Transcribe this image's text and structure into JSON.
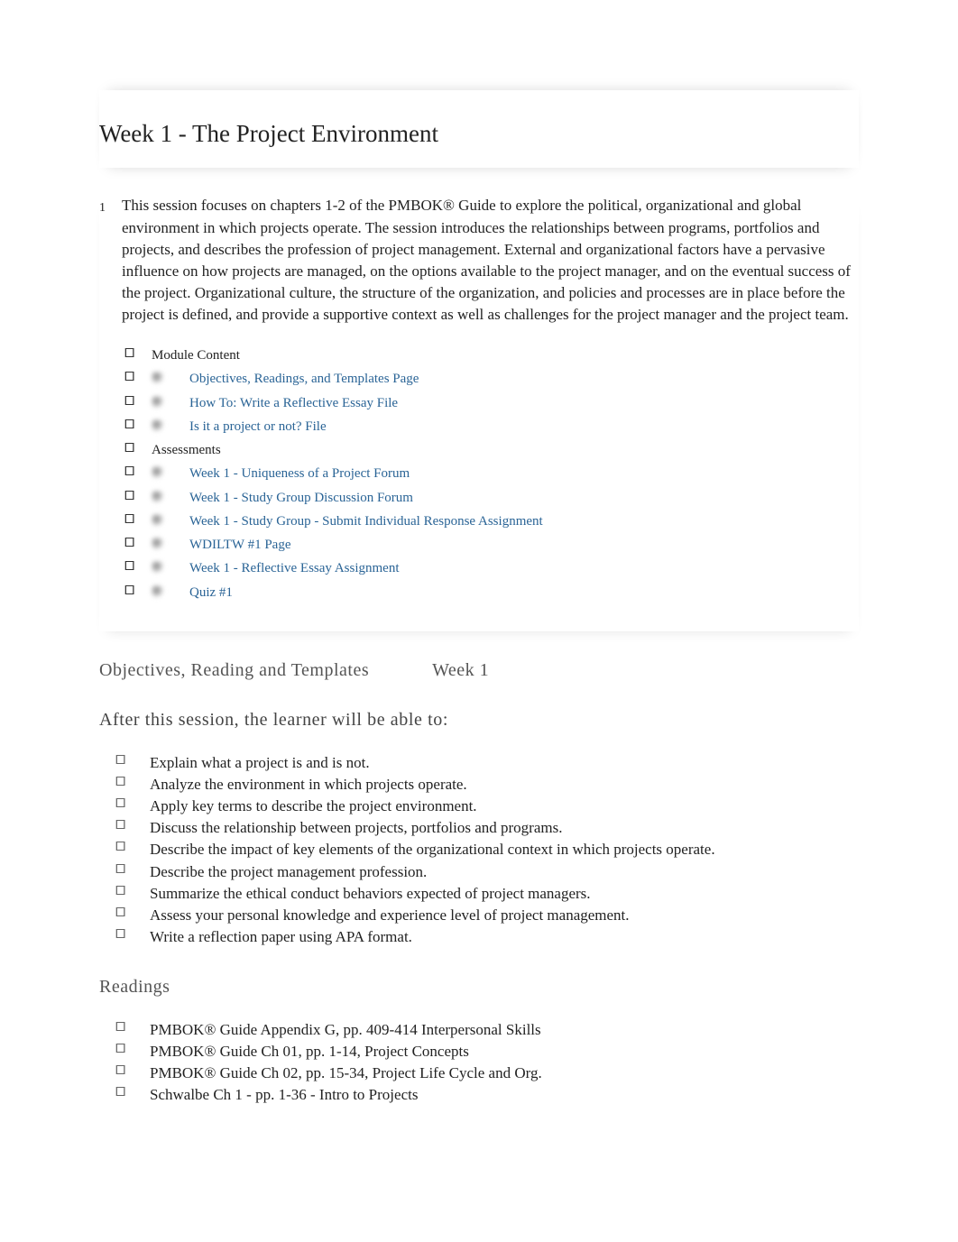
{
  "header": {
    "title": "Week 1 - The Project Environment"
  },
  "section": {
    "number": "1",
    "intro": "This session focuses on chapters 1-2 of the PMBOK® Guide to explore the political, organizational and global environment in which projects operate. The session introduces the relationships between programs, portfolios and projects, and describes the profession of project management. External and organizational factors have a pervasive influence on how projects are managed, on the options available to the project manager, and on the eventual success of the project. Organizational culture, the structure of the organization, and policies and processes are in place before the project is defined, and provide a supportive context as well as challenges for the project manager and the project team."
  },
  "module": {
    "content_header": "Module Content",
    "content_items": [
      "Objectives, Readings, and Templates Page",
      "How To: Write a Reflective Essay File",
      "Is it a project or not? File"
    ],
    "assessments_header": "Assessments",
    "assessment_items": [
      "Week 1 - Uniqueness of a Project Forum",
      "Week 1 - Study Group Discussion Forum",
      "Week 1 - Study Group - Submit Individual Response Assignment",
      "WDILTW #1 Page",
      "Week 1 - Reflective Essay Assignment",
      "Quiz #1"
    ]
  },
  "objectives_section": {
    "heading_left": "Objectives, Reading and Templates",
    "heading_right": "Week 1",
    "subtitle": "After this session, the learner will be able to:",
    "objectives": [
      "Explain what a project is and is not.",
      "Analyze the environment in which projects operate.",
      "Apply key terms to describe the project environment.",
      "Discuss the relationship between projects, portfolios and programs.",
      "Describe the impact of key elements of the organizational context in which projects operate.",
      "Describe the project management profession.",
      "Summarize the ethical conduct behaviors expected of project managers.",
      "Assess your personal knowledge and experience level of project management.",
      "Write a reflection paper using APA format."
    ]
  },
  "readings_section": {
    "heading": "Readings",
    "items": [
      "PMBOK® Guide   Appendix G, pp. 409-414 Interpersonal Skills",
      "PMBOK® Guide   Ch 01, pp. 1-14, Project Concepts",
      "PMBOK® Guide   Ch 02, pp. 15-34, Project Life Cycle and Org.",
      "Schwalbe Ch 1 - pp. 1-36 - Intro to Projects"
    ]
  }
}
